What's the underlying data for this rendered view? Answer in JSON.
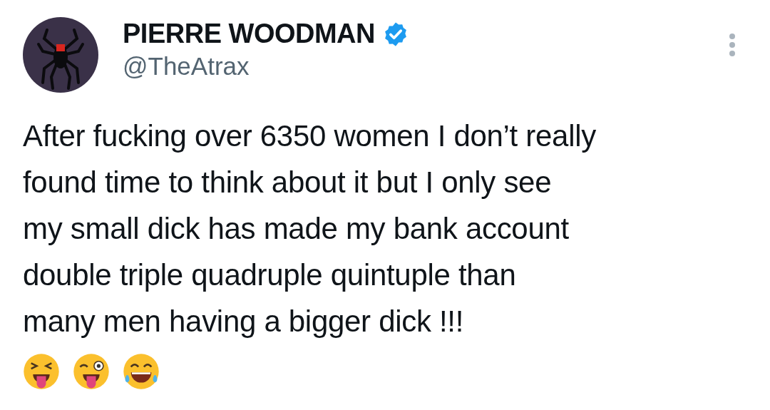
{
  "author": {
    "name": "PIERRE WOODMAN",
    "verified": true,
    "handle": "@TheAtrax"
  },
  "text_lines": [
    "After fucking over 6350 women I don’t really",
    "found time to think about it but I only see",
    "my small dick has made my bank account",
    "double triple quadruple quintuple than",
    "many men having a bigger dick !!!"
  ]
}
